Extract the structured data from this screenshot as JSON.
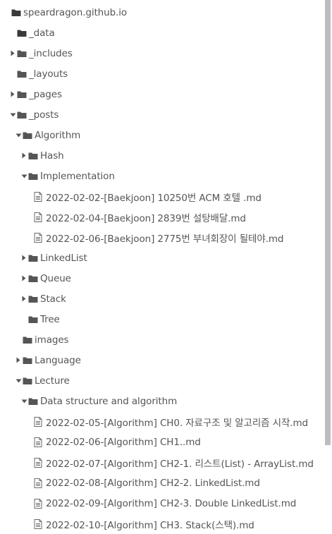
{
  "tree": [
    {
      "label": "speardragon.github.io",
      "type": "folder",
      "depth": 0,
      "arrow": "none",
      "dark": true
    },
    {
      "label": "_data",
      "type": "folder",
      "depth": 1,
      "arrow": "none",
      "dark": true
    },
    {
      "label": "_includes",
      "type": "folder",
      "depth": 1,
      "arrow": "right"
    },
    {
      "label": "_layouts",
      "type": "folder",
      "depth": 1,
      "arrow": "none"
    },
    {
      "label": "_pages",
      "type": "folder",
      "depth": 1,
      "arrow": "right"
    },
    {
      "label": "_posts",
      "type": "folder",
      "depth": 1,
      "arrow": "down"
    },
    {
      "label": "Algorithm",
      "type": "folder",
      "depth": 2,
      "arrow": "down"
    },
    {
      "label": "Hash",
      "type": "folder",
      "depth": 3,
      "arrow": "right"
    },
    {
      "label": "Implementation",
      "type": "folder",
      "depth": 3,
      "arrow": "down"
    },
    {
      "label": "2022-02-02-[Baekjoon] 10250번 ACM 호텔 .md",
      "type": "file",
      "depth": 4,
      "arrow": "none"
    },
    {
      "label": "2022-02-04-[Baekjoon] 2839번 설탕배달.md",
      "type": "file",
      "depth": 4,
      "arrow": "none"
    },
    {
      "label": "2022-02-06-[Baekjoon] 2775번 부녀회장이 될테야.md",
      "type": "file",
      "depth": 4,
      "arrow": "none"
    },
    {
      "label": "LinkedList",
      "type": "folder",
      "depth": 3,
      "arrow": "right"
    },
    {
      "label": "Queue",
      "type": "folder",
      "depth": 3,
      "arrow": "right"
    },
    {
      "label": "Stack",
      "type": "folder",
      "depth": 3,
      "arrow": "right"
    },
    {
      "label": "Tree",
      "type": "folder",
      "depth": 3,
      "arrow": "none"
    },
    {
      "label": "images",
      "type": "folder",
      "depth": 2,
      "arrow": "none"
    },
    {
      "label": "Language",
      "type": "folder",
      "depth": 2,
      "arrow": "right"
    },
    {
      "label": "Lecture",
      "type": "folder",
      "depth": 2,
      "arrow": "down"
    },
    {
      "label": "Data structure and algorithm",
      "type": "folder",
      "depth": 3,
      "arrow": "down"
    },
    {
      "label": "2022-02-05-[Algorithm] CH0. 자료구조 및 알고리즘 시작.md",
      "type": "file",
      "depth": 4,
      "arrow": "none"
    },
    {
      "label": "2022-02-06-[Algorithm] CH1..md",
      "type": "file",
      "depth": 4,
      "arrow": "none"
    },
    {
      "label": "2022-02-07-[Algorithm] CH2-1. 리스트(List) - ArrayList.md",
      "type": "file",
      "depth": 4,
      "arrow": "none"
    },
    {
      "label": "2022-02-08-[Algorithm] CH2-2. LinkedList.md",
      "type": "file",
      "depth": 4,
      "arrow": "none"
    },
    {
      "label": "2022-02-09-[Algorithm] CH2-3. Double LinkedList.md",
      "type": "file",
      "depth": 4,
      "arrow": "none"
    },
    {
      "label": "2022-02-10-[Algorithm] CH3. Stack(스택).md",
      "type": "file",
      "depth": 4,
      "arrow": "none"
    }
  ],
  "colors": {
    "folder": "#555555",
    "folder_dark": "#3a3a3a",
    "file": "#6a6a6a",
    "arrow": "#555555",
    "text": "#555555",
    "scroll_thumb": "#bdbdbd"
  },
  "scroll": {
    "thumb_fraction": 0.846
  }
}
